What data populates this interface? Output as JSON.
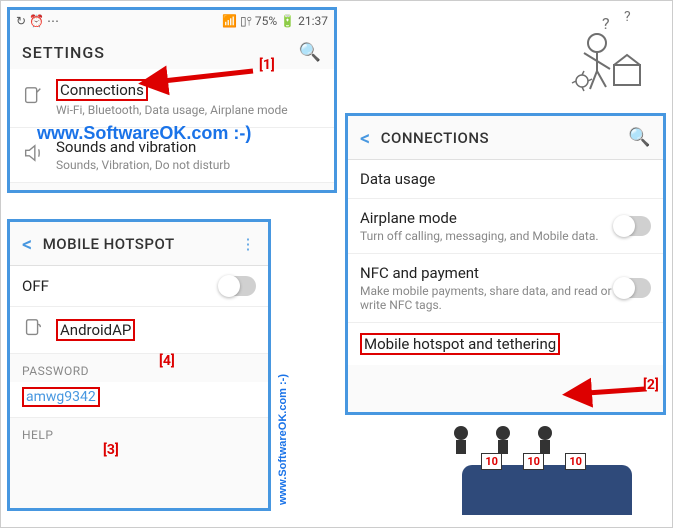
{
  "statusbar": {
    "battery": "75%",
    "time": "21:37"
  },
  "settings": {
    "title": "SETTINGS",
    "items": [
      {
        "label": "Connections",
        "sub": "Wi-Fi, Bluetooth, Data usage, Airplane mode"
      },
      {
        "label": "Sounds and vibration",
        "sub": "Sounds, Vibration, Do not disturb"
      }
    ]
  },
  "connections": {
    "title": "CONNECTIONS",
    "items": [
      {
        "label": "Data usage",
        "sub": "",
        "toggle": false
      },
      {
        "label": "Airplane mode",
        "sub": "Turn off calling, messaging, and Mobile data.",
        "toggle": true
      },
      {
        "label": "NFC and payment",
        "sub": "Make mobile payments, share data, and read or write NFC tags.",
        "toggle": true
      },
      {
        "label": "Mobile hotspot and tethering",
        "sub": "",
        "toggle": false
      }
    ]
  },
  "hotspot": {
    "title": "MOBILE HOTSPOT",
    "state": "OFF",
    "ap_name": "AndroidAP",
    "password_label": "PASSWORD",
    "password": "amwg9342",
    "help_label": "HELP"
  },
  "callouts": {
    "c1": "[1]",
    "c2": "[2]",
    "c3": "[3]",
    "c4": "[4]"
  },
  "watermark": {
    "text1": "www.SoftwareOK.com :-)",
    "text2": "www.SoftwareOK.com :-)"
  },
  "judges": {
    "score": "10"
  }
}
